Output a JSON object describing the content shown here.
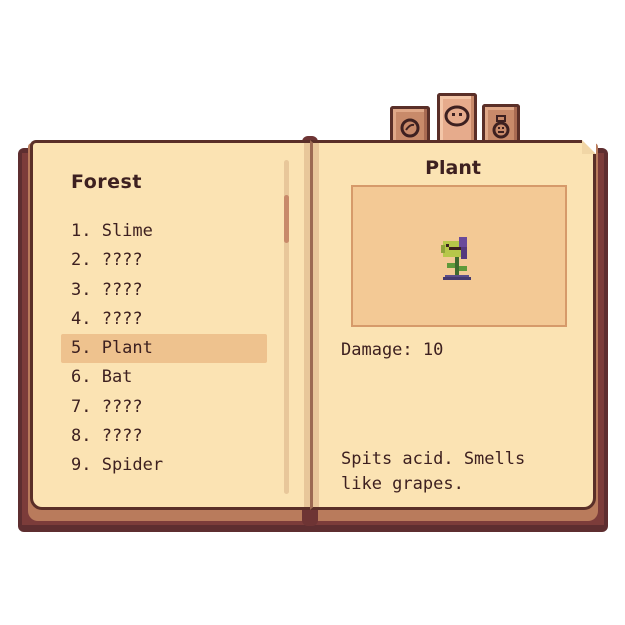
{
  "tabs": [
    {
      "icon": "ring-icon",
      "active": false
    },
    {
      "icon": "creature-face-icon",
      "active": true
    },
    {
      "icon": "potion-bag-icon",
      "active": false
    }
  ],
  "left_page": {
    "section_title": "Forest",
    "entries": [
      {
        "label": "1. Slime"
      },
      {
        "label": "2. ????"
      },
      {
        "label": "3. ????"
      },
      {
        "label": "4. ????"
      },
      {
        "label": "5. Plant",
        "selected": true
      },
      {
        "label": "6. Bat"
      },
      {
        "label": "7. ????"
      },
      {
        "label": "8. ????"
      },
      {
        "label": "9. Spider"
      }
    ]
  },
  "right_page": {
    "creature_name": "Plant",
    "portrait_icon": "plant-monster-icon",
    "damage_text": "Damage: 10",
    "description": "Spits acid. Smells like grapes."
  },
  "colors": {
    "page": "#fbe3b3",
    "cover": "#5e2e30",
    "selected_row": "#eec28e",
    "text": "#3d2020"
  }
}
